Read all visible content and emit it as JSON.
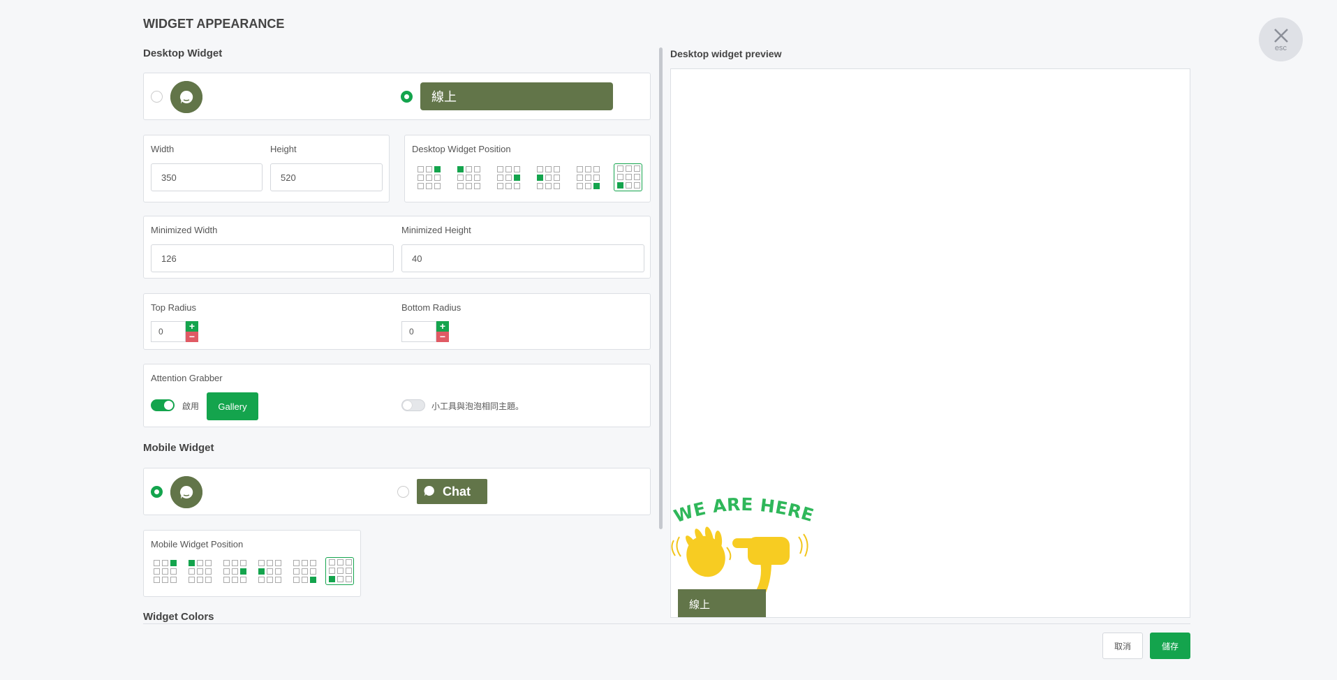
{
  "page_title": "WIDGET APPEARANCE",
  "close_button": {
    "label": "esc",
    "icon": "close-icon"
  },
  "desktop_widget": {
    "section_title": "Desktop Widget",
    "tab_label": "線上",
    "selected_type": "tab",
    "width_label": "Width",
    "width_value": "350",
    "height_label": "Height",
    "height_value": "520",
    "position_label": "Desktop Widget Position",
    "selected_position": "bottom-left",
    "minimized_width_label": "Minimized Width",
    "minimized_width_value": "126",
    "minimized_height_label": "Minimized Height",
    "minimized_height_value": "40",
    "top_radius_label": "Top Radius",
    "top_radius_value": "0",
    "bottom_radius_label": "Bottom Radius",
    "bottom_radius_value": "0",
    "attention_grabber_label": "Attention Grabber",
    "attention_grabber_enabled": true,
    "enable_label": "啟用",
    "gallery_button": "Gallery",
    "same_theme_enabled": false,
    "same_theme_label": "小工具與泡泡相同主題。"
  },
  "mobile_widget": {
    "section_title": "Mobile Widget",
    "selected_type": "bubble",
    "chat_label": "Chat",
    "position_label": "Mobile Widget Position",
    "selected_position": "bottom-left"
  },
  "widget_colors_title": "Widget Colors",
  "preview": {
    "title": "Desktop widget preview",
    "attention_text": "WE ARE HERE!",
    "tab_label": "線上"
  },
  "footer": {
    "cancel_label": "取消",
    "save_label": "儲存"
  },
  "colors": {
    "accent": "#14a44d",
    "widget": "#627549",
    "danger": "#e05a64"
  }
}
